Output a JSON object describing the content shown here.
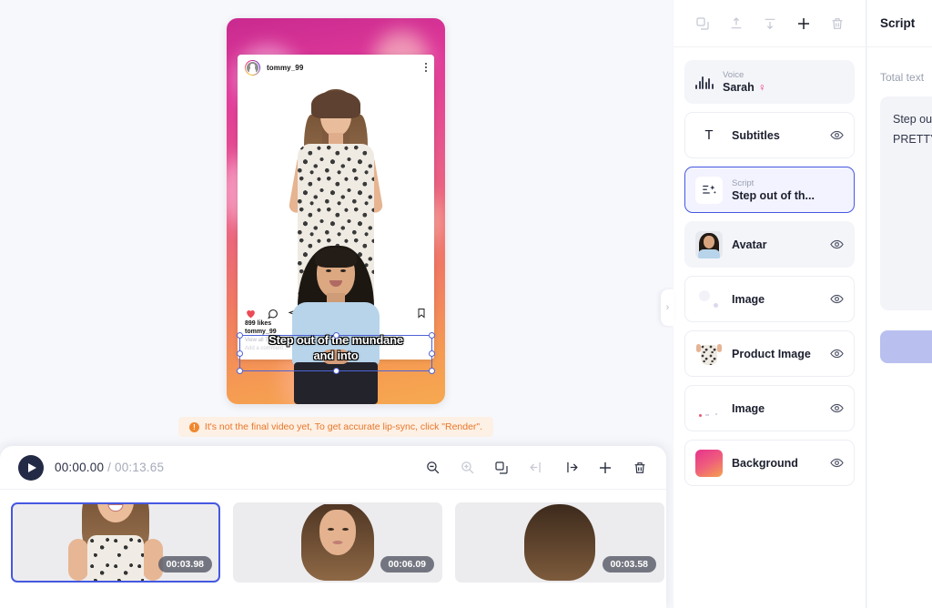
{
  "preview": {
    "instagram": {
      "username": "tommy_99",
      "likes": "899 likes",
      "caption_user": "tommy_99",
      "comments_hint": "View all 73 comments",
      "add_comment": "Add a comment...",
      "menu_icon": "kebab-menu-icon",
      "like_icon": "heart-icon",
      "comment_icon": "speech-bubble-icon",
      "share_icon": "paper-plane-icon",
      "save_icon": "bookmark-icon"
    },
    "subtitle": {
      "line1": "Step out of the mundane",
      "line2": "and into"
    },
    "warning": {
      "icon": "info-icon",
      "icon_glyph": "!",
      "text": "It's not the final video yet, To get accurate lip-sync, click \"Render\"."
    }
  },
  "timeline": {
    "play_icon": "play-icon",
    "current_time": "00:00.00",
    "separator": " / ",
    "total_time": "00:13.65",
    "tools": [
      {
        "name": "zoom-out-icon",
        "label": "Zoom out",
        "disabled": false
      },
      {
        "name": "zoom-in-icon",
        "label": "Zoom in",
        "disabled": true
      },
      {
        "name": "duplicate-icon",
        "label": "Duplicate",
        "disabled": false
      },
      {
        "name": "split-left-icon",
        "label": "Split left",
        "disabled": true
      },
      {
        "name": "split-right-icon",
        "label": "Split right",
        "disabled": false
      },
      {
        "name": "add-scene-icon",
        "label": "Add scene",
        "disabled": false
      },
      {
        "name": "delete-icon",
        "label": "Delete",
        "disabled": false
      }
    ],
    "scenes": [
      {
        "duration": "00:03.98",
        "selected": true
      },
      {
        "duration": "00:06.09",
        "selected": false
      },
      {
        "duration": "00:03.58",
        "selected": false
      }
    ]
  },
  "layers_panel": {
    "toolbar": [
      {
        "name": "duplicate-layer-icon",
        "label": "Duplicate",
        "active": false
      },
      {
        "name": "bring-to-front-icon",
        "label": "Bring to front",
        "active": false
      },
      {
        "name": "send-to-back-icon",
        "label": "Send to back",
        "active": false
      },
      {
        "name": "add-layer-icon",
        "label": "Add",
        "active": true
      },
      {
        "name": "delete-layer-icon",
        "label": "Delete",
        "active": false
      }
    ],
    "voice": {
      "label": "Voice",
      "value": "Sarah",
      "gender_icon": "female-symbol-icon",
      "gender_glyph": "♀",
      "gender_color": "#e8337f",
      "icon": "waveform-icon"
    },
    "subtitles": {
      "title": "Subtitles",
      "icon": "text-t-icon",
      "icon_glyph": "T",
      "eye_icon": "eye-icon"
    },
    "script": {
      "label": "Script",
      "value": "Step out of th...",
      "icon": "magic-script-icon",
      "selected": true
    },
    "items": [
      {
        "title": "Avatar",
        "thumb": "avatar-thumb",
        "eye_icon": "eye-icon",
        "highlight": true
      },
      {
        "title": "Image",
        "thumb": "image-thumb",
        "eye_icon": "eye-icon",
        "highlight": false
      },
      {
        "title": "Product Image",
        "thumb": "product-thumb",
        "eye_icon": "eye-icon",
        "highlight": false
      },
      {
        "title": "Image",
        "thumb": "image2-thumb",
        "eye_icon": "eye-icon",
        "highlight": false
      },
      {
        "title": "Background",
        "thumb": "gradient-thumb",
        "eye_icon": "eye-icon",
        "highlight": false
      }
    ]
  },
  "collapse_handle": {
    "name": "collapse-panel-chevron",
    "glyph": "›"
  },
  "script_panel": {
    "title": "Script",
    "total_text_label": "Total text",
    "script_line1": "Step ou",
    "script_line2": "PRETTY"
  },
  "colors": {
    "accent": "#4558e0",
    "warning": "#e8762a",
    "warning_bg": "#fdf0e4",
    "pink": "#e8337f"
  }
}
